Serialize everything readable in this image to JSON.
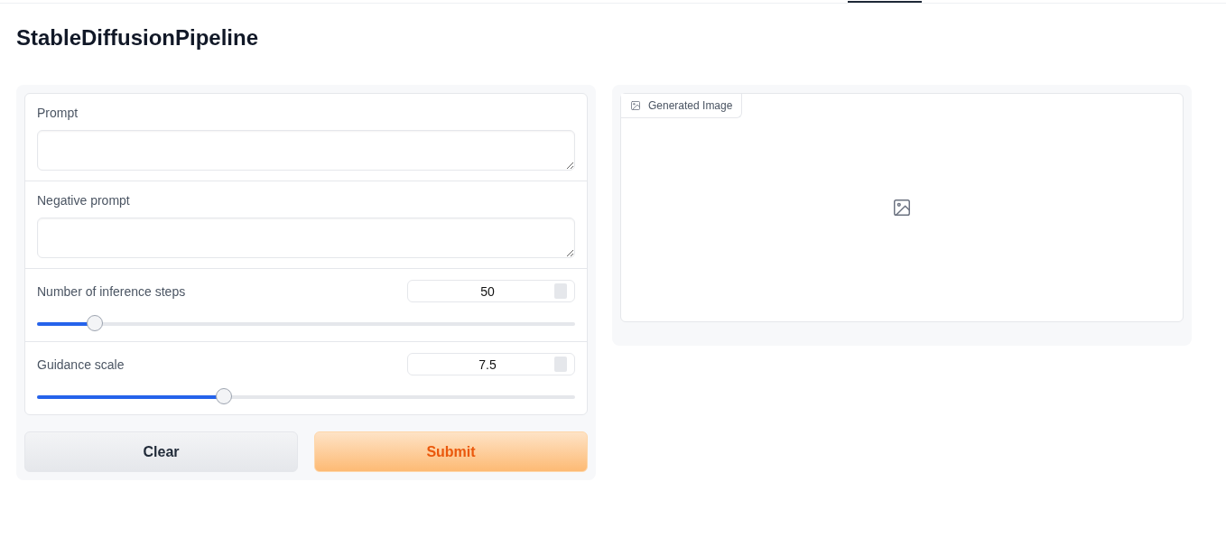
{
  "title": "StableDiffusionPipeline",
  "inputs": [
    {
      "kind": "text",
      "label": "Prompt"
    },
    {
      "kind": "text",
      "label": "Negative prompt"
    },
    {
      "kind": "slider",
      "label": "Number of inference steps",
      "value": "50",
      "level": 0.107
    },
    {
      "kind": "slider",
      "label": "Guidance scale",
      "value": "7.5",
      "level": 0.347
    }
  ],
  "buttons": [
    {
      "label": "Clear",
      "kind": "secondary"
    },
    {
      "label": "Submit",
      "kind": "primary"
    }
  ],
  "output": {
    "label": "Generated Image"
  }
}
